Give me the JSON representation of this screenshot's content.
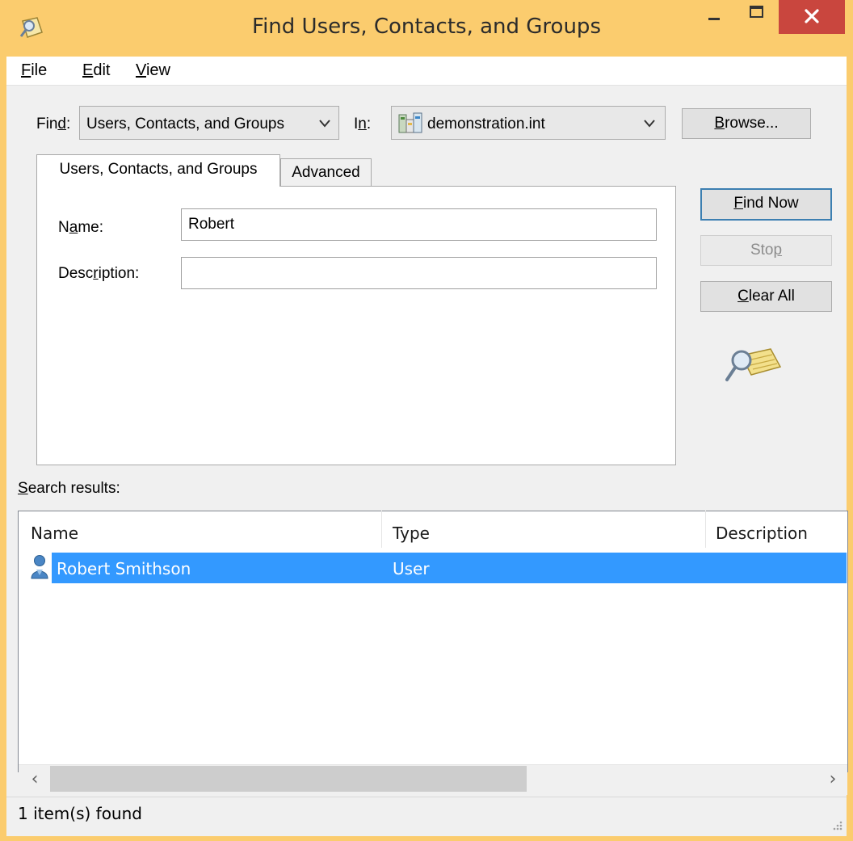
{
  "window": {
    "title": "Find Users, Contacts, and Groups",
    "icons": {
      "app": "directory-search-icon",
      "minimize": "minimize-icon",
      "maximize": "maximize-icon",
      "close": "close-icon"
    },
    "colors": {
      "frame": "#fbcc6e",
      "close": "#c9463e",
      "selection": "#3399ff"
    }
  },
  "menu": {
    "file": {
      "hotkey": "F",
      "rest": "ile"
    },
    "edit": {
      "hotkey": "E",
      "rest": "dit"
    },
    "view": {
      "hotkey": "V",
      "rest": "iew"
    }
  },
  "find": {
    "label_pre": "Fin",
    "label_hotkey": "d",
    "label_post": ":",
    "value": "Users, Contacts, and Groups",
    "dropdown_icon": "chevron-down-icon"
  },
  "scope": {
    "label_pre": "I",
    "label_hotkey": "n",
    "label_post": ":",
    "value": "demonstration.int",
    "icon": "domain-icon"
  },
  "buttons": {
    "browse": {
      "hotkey": "B",
      "rest": "rowse..."
    },
    "find_now": {
      "pre": "",
      "hotkey": "F",
      "rest": "ind Now"
    },
    "stop": {
      "pre": "Sto",
      "hotkey": "p",
      "rest": ""
    },
    "clear_all": {
      "pre": "",
      "hotkey": "C",
      "rest": "lear All"
    }
  },
  "tabs": [
    {
      "label": "Users, Contacts, and Groups",
      "active": true
    },
    {
      "label": "Advanced",
      "active": false
    }
  ],
  "form": {
    "name": {
      "pre": "N",
      "hotkey": "a",
      "rest": "me:",
      "value": "Robert"
    },
    "description": {
      "pre": "Desc",
      "hotkey": "r",
      "rest": "iption:",
      "value": ""
    }
  },
  "search_illustration": "magnifier-directory-icon",
  "results": {
    "label_hotkey": "S",
    "label_rest": "earch results:",
    "columns": [
      "Name",
      "Type",
      "Description"
    ],
    "rows": [
      {
        "name": "Robert Smithson",
        "type": "User",
        "description": "",
        "icon": "user-icon",
        "selected": true
      }
    ]
  },
  "status": {
    "text": "1 item(s) found",
    "grip_icon": "resize-grip-icon"
  }
}
